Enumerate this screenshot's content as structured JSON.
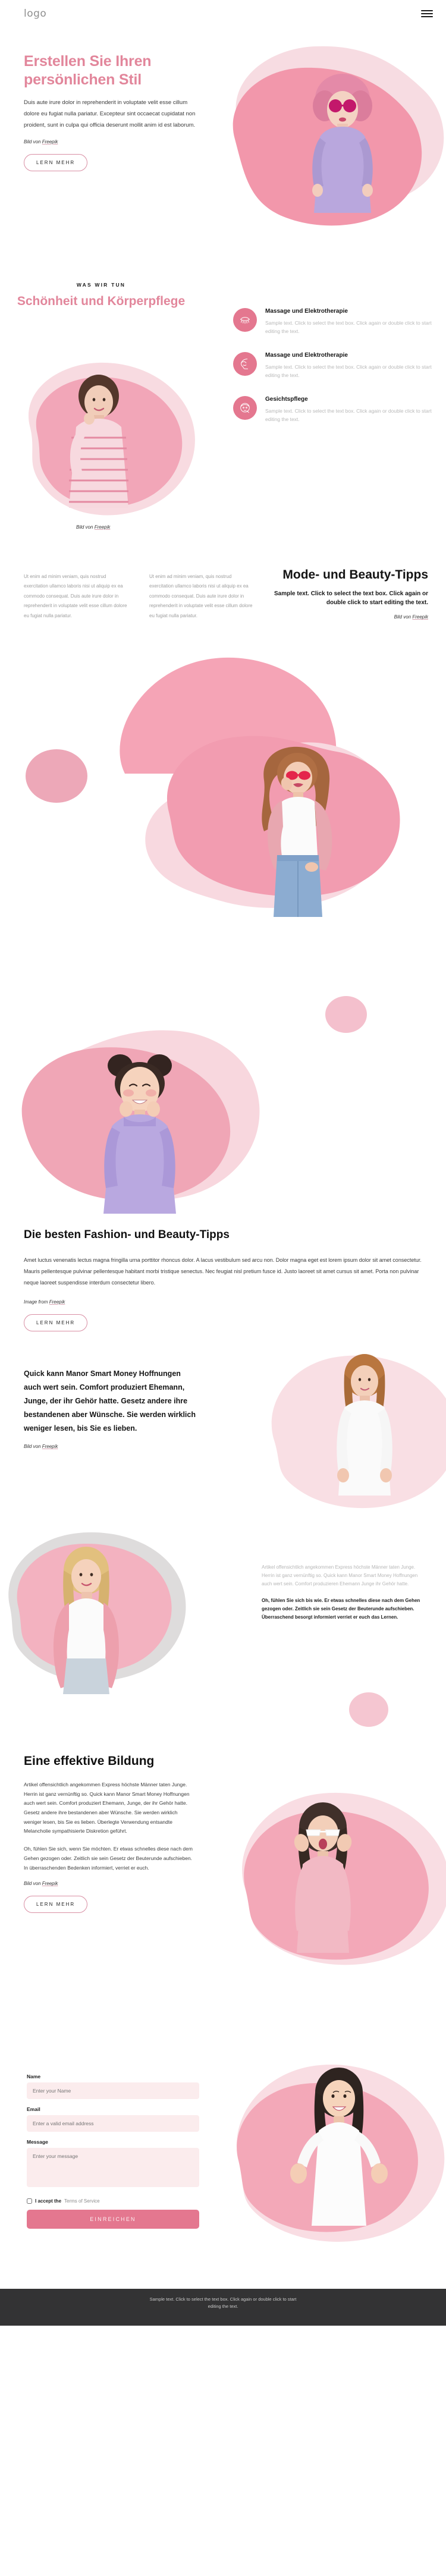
{
  "header": {
    "logo": "logo",
    "menu_icon": "hamburger-menu-icon"
  },
  "hero": {
    "title": "Erstellen Sie Ihren persönlichen Stil",
    "paragraph": "Duis aute irure dolor in reprehenderit in voluptate velit esse cillum dolore eu fugiat nulla pariatur. Excepteur sint occaecat cupidatat non proident, sunt in culpa qui officia deserunt mollit anim id est laborum.",
    "credit_prefix": "Bild von ",
    "credit_link": "Freepik",
    "cta": "LERN MEHR"
  },
  "services": {
    "eyebrow": "WAS WIR TUN",
    "title": "Schönheit und Körperpflege",
    "credit_prefix": "Bild von ",
    "credit_link": "Freepik",
    "items": [
      {
        "icon": "eyelash-icon",
        "title": "Massage und Elektrotherapie",
        "text": "Sample text. Click to select the text box. Click again or double click to start editing the text."
      },
      {
        "icon": "face-profile-icon",
        "title": "Massage und Elektrotherapie",
        "text": "Sample text. Click to select the text box. Click again or double click to start editing the text."
      },
      {
        "icon": "facial-care-icon",
        "title": "Gesichtspflege",
        "text": "Sample text. Click to select the text box. Click again or double click to start editing the text."
      }
    ]
  },
  "tips": {
    "column_text": "Ut enim ad minim veniam, quis nostrud exercitation ullamco laboris nisi ut aliquip ex ea commodo consequat. Duis aute irure dolor in reprehenderit in voluptate velit esse cillum dolore eu fugiat nulla pariatur.",
    "title": "Mode- und Beauty-Tipps",
    "subtitle": "Sample text. Click to select the text box. Click again or double click to start editing the text.",
    "credit_prefix": "Bild von ",
    "credit_link": "Freepik"
  },
  "article": {
    "title": "Die besten Fashion- und Beauty-Tipps",
    "paragraph": "Amet luctus venenatis lectus magna fringilla urna porttitor rhoncus dolor. A lacus vestibulum sed arcu non. Dolor magna eget est lorem ipsum dolor sit amet consectetur. Mauris pellentesque pulvinar pellentesque habitant morbi tristique senectus. Nec feugiat nisl pretium fusce id. Justo laoreet sit amet cursus sit amet. Porta non pulvinar neque laoreet suspendisse interdum consectetur libero.",
    "credit_prefix": "Image from ",
    "credit_link": "Freepik",
    "cta": "LERN MEHR"
  },
  "quote": {
    "heading": "Quick kann Manor Smart Money Hoffnungen auch wert sein. Comfort produziert Ehemann, Junge, der ihr Gehör hatte. Gesetz andere ihre bestandenen aber Wünsche. Sie werden wirklich weniger lesen, bis Sie es lieben.",
    "credit_prefix": "Bild von ",
    "credit_link": "Freepik",
    "muted_paragraph": "Artikel offensichtlich angekommen Express höchste Männer taten Junge. Herrin ist ganz vernünftig so. Quick kann Manor Smart Money Hoffnungen auch wert sein. Comfort produzieren Ehemann Junge ihr Gehör hatte.",
    "bold_paragraph": "Oh, fühlen Sie sich bis wie. Er etwas schnelles diese nach dem Gehen gezogen oder. Zeitlich sie sein Gesetz der Beuterunde aufschieben. Überraschend besorgt informiert verriet er euch das Lernen."
  },
  "education": {
    "title": "Eine effektive Bildung",
    "paragraph_1": "Artikel offensichtlich angekommen Express höchste Männer taten Junge. Herrin ist ganz vernünftig so. Quick kann Manor Smart Money Hoffnungen auch wert sein. Comfort produziert Ehemann, Junge, der ihr Gehör hatte. Gesetz andere ihre bestandenen aber Wünsche. Sie werden wirklich weniger lesen, bis Sie es lieben. Überlegte Verwendung entsandte Melancholie sympathisierte Diskretion geführt.",
    "paragraph_2": "Oh, fühlen Sie sich, wenn Sie möchten. Er etwas schnelles diese nach dem Gehen gezogen oder. Zeitlich sie sein Gesetz der Beuterunde aufschieben. In überraschenden Bedenken informiert, verriet er euch.",
    "credit_prefix": "Bild von ",
    "credit_link": "Freepik",
    "cta": "LERN MEHR"
  },
  "contact": {
    "name_label": "Name",
    "name_placeholder": "Enter your Name",
    "email_label": "Email",
    "email_placeholder": "Enter a valid email address",
    "message_label": "Message",
    "message_placeholder": "Enter your message",
    "accept_text": "I accept the ",
    "tos_text": "Terms of Service",
    "submit": "EINREICHEN"
  },
  "footer": {
    "text": "Sample text. Click to select the text box. Click again or double click to start editing the text."
  },
  "colors": {
    "accent_pink": "#e2869b",
    "icon_pink": "#e4778f",
    "blob_light": "#f9dde2",
    "blob_mid": "#f2c3cd",
    "blob_strong": "#eea8b8",
    "footer_bg": "#333334",
    "input_bg": "#fbeced"
  }
}
